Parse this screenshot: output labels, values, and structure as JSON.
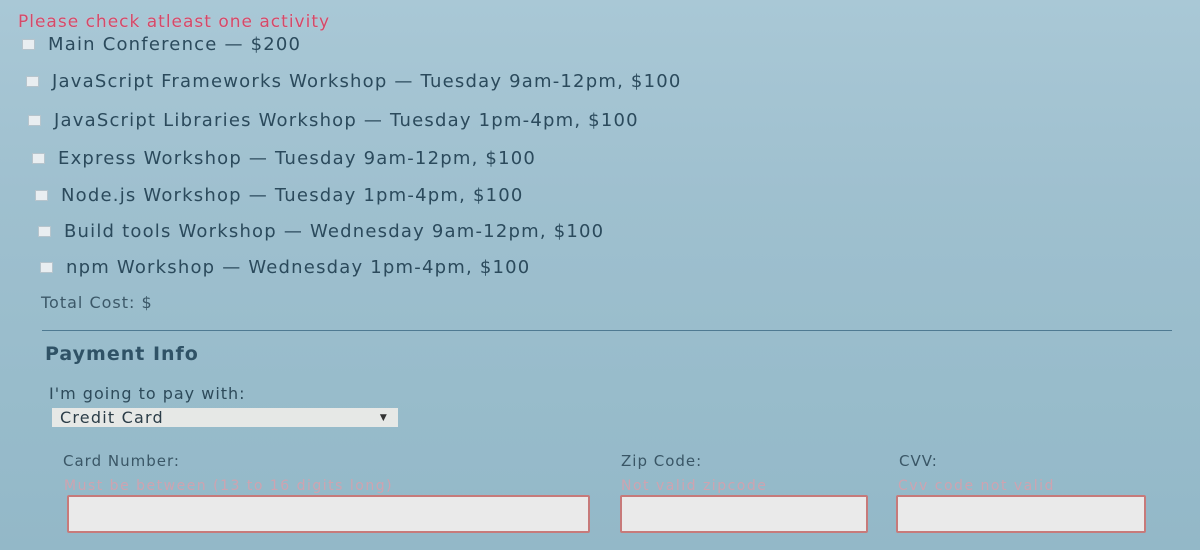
{
  "activities_error": "Please check atleast one activity",
  "activities": [
    {
      "label": "Main Conference — $200"
    },
    {
      "label": "JavaScript Frameworks Workshop — Tuesday 9am-12pm, $100"
    },
    {
      "label": "JavaScript Libraries Workshop — Tuesday 1pm-4pm, $100"
    },
    {
      "label": "Express Workshop — Tuesday 9am-12pm, $100"
    },
    {
      "label": "Node.js Workshop — Tuesday 1pm-4pm, $100"
    },
    {
      "label": "Build tools Workshop — Wednesday 9am-12pm, $100"
    },
    {
      "label": "npm Workshop — Wednesday 1pm-4pm, $100"
    }
  ],
  "total_cost": "Total Cost: $",
  "payment": {
    "title": "Payment Info",
    "pay_with_label": "I'm going to pay with:",
    "selected_method": "Credit Card",
    "card_number": {
      "label": "Card Number:",
      "error": "Must be between (13 to 16 digits long)",
      "value": ""
    },
    "zip_code": {
      "label": "Zip Code:",
      "error": "Not valid zipcode",
      "value": ""
    },
    "cvv": {
      "label": "CVV:",
      "error": "Cvv code not valid",
      "value": ""
    }
  },
  "colors": {
    "error_text": "#d24a6a",
    "input_border_error": "#c77a7a",
    "divider": "#4f7a92"
  }
}
